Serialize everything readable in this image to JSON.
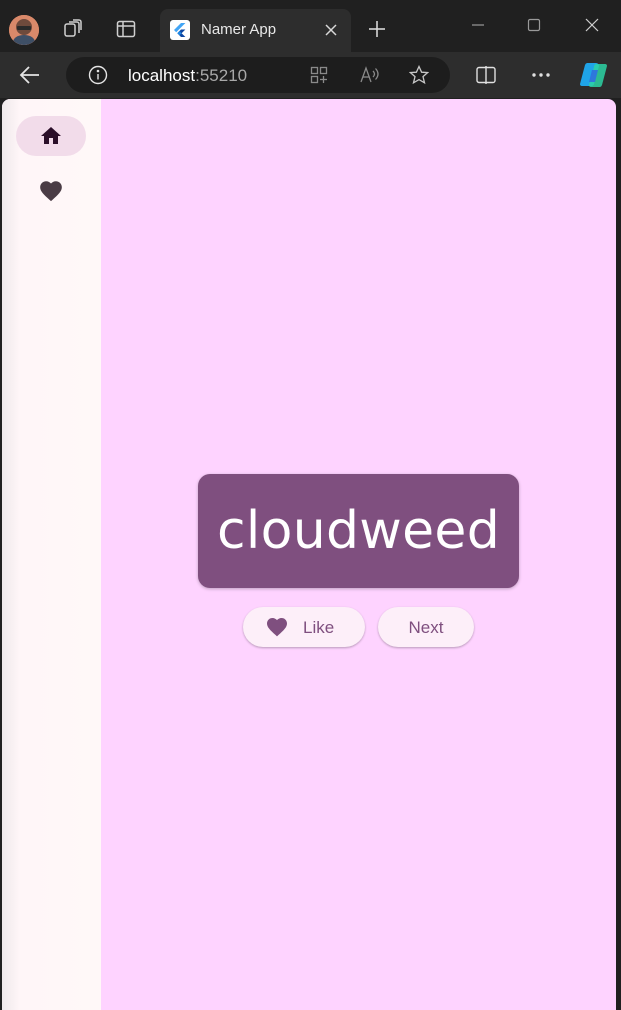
{
  "browser": {
    "tab": {
      "title": "Namer App"
    },
    "address": {
      "host": "localhost",
      "port": ":55210"
    }
  },
  "app": {
    "nav": [
      {
        "icon": "home-icon",
        "selected": true
      },
      {
        "icon": "heart-icon",
        "selected": false
      }
    ],
    "current_word": "cloudweed",
    "like_label": "Like",
    "next_label": "Next"
  },
  "colors": {
    "background": "#fed3ff",
    "card": "#7f4f7f",
    "rail": "#fff8f8",
    "button": "#fdeff9"
  }
}
